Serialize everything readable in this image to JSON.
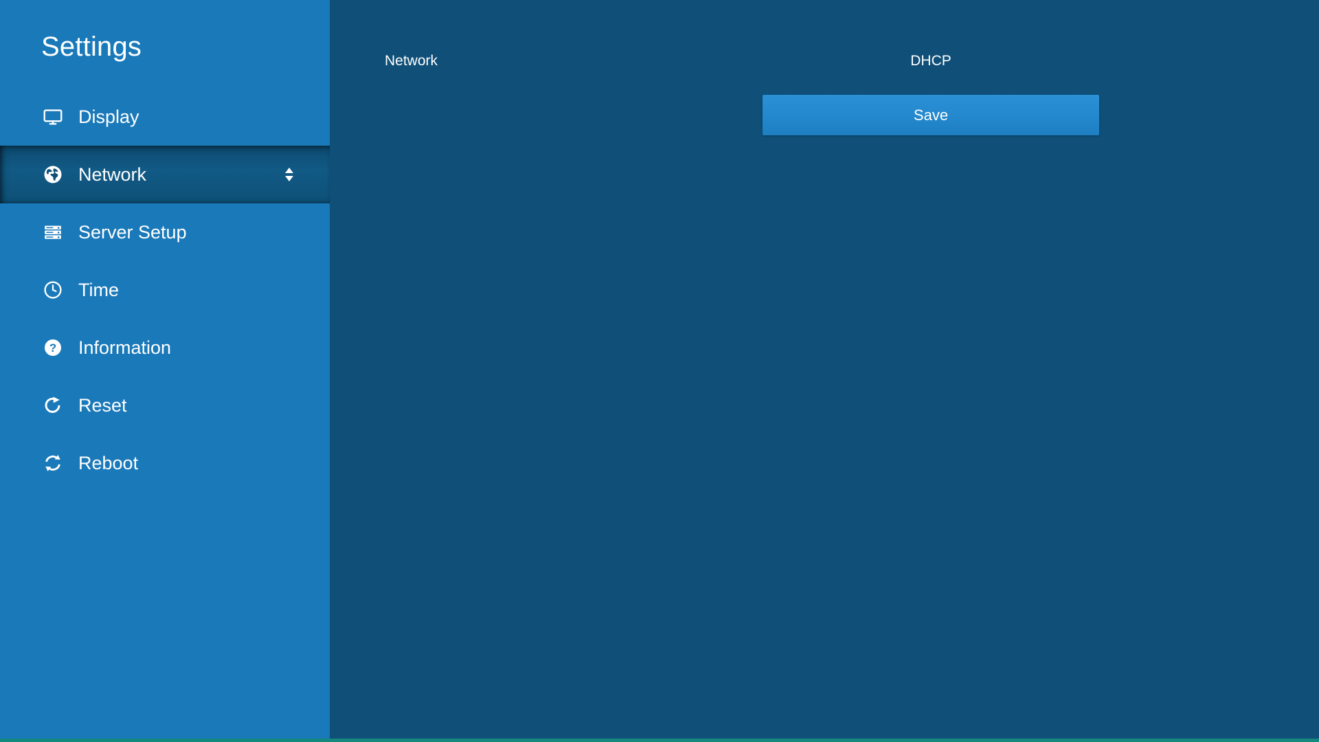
{
  "sidebar": {
    "title": "Settings",
    "items": [
      {
        "label": "Display",
        "icon": "monitor-icon",
        "selected": false,
        "trailing": null
      },
      {
        "label": "Network",
        "icon": "globe-icon",
        "selected": true,
        "trailing": "sort-up-down-icon"
      },
      {
        "label": "Server Setup",
        "icon": "server-icon",
        "selected": false,
        "trailing": null
      },
      {
        "label": "Time",
        "icon": "clock-icon",
        "selected": false,
        "trailing": null
      },
      {
        "label": "Information",
        "icon": "question-mark-icon",
        "selected": false,
        "trailing": null
      },
      {
        "label": "Reset",
        "icon": "rotate-right-icon",
        "selected": false,
        "trailing": null
      },
      {
        "label": "Reboot",
        "icon": "sync-refresh-icon",
        "selected": false,
        "trailing": null
      }
    ]
  },
  "main": {
    "network_label": "Network",
    "dhcp_label": "DHCP",
    "save_label": "Save"
  },
  "colors": {
    "sidebar_background": "#1a79b9",
    "sidebar_selected_background": "#0e5077",
    "main_background": "#0f4f78",
    "save_button": "#2489cf",
    "text": "#ffffff",
    "bottom_strip": "#16897f"
  }
}
